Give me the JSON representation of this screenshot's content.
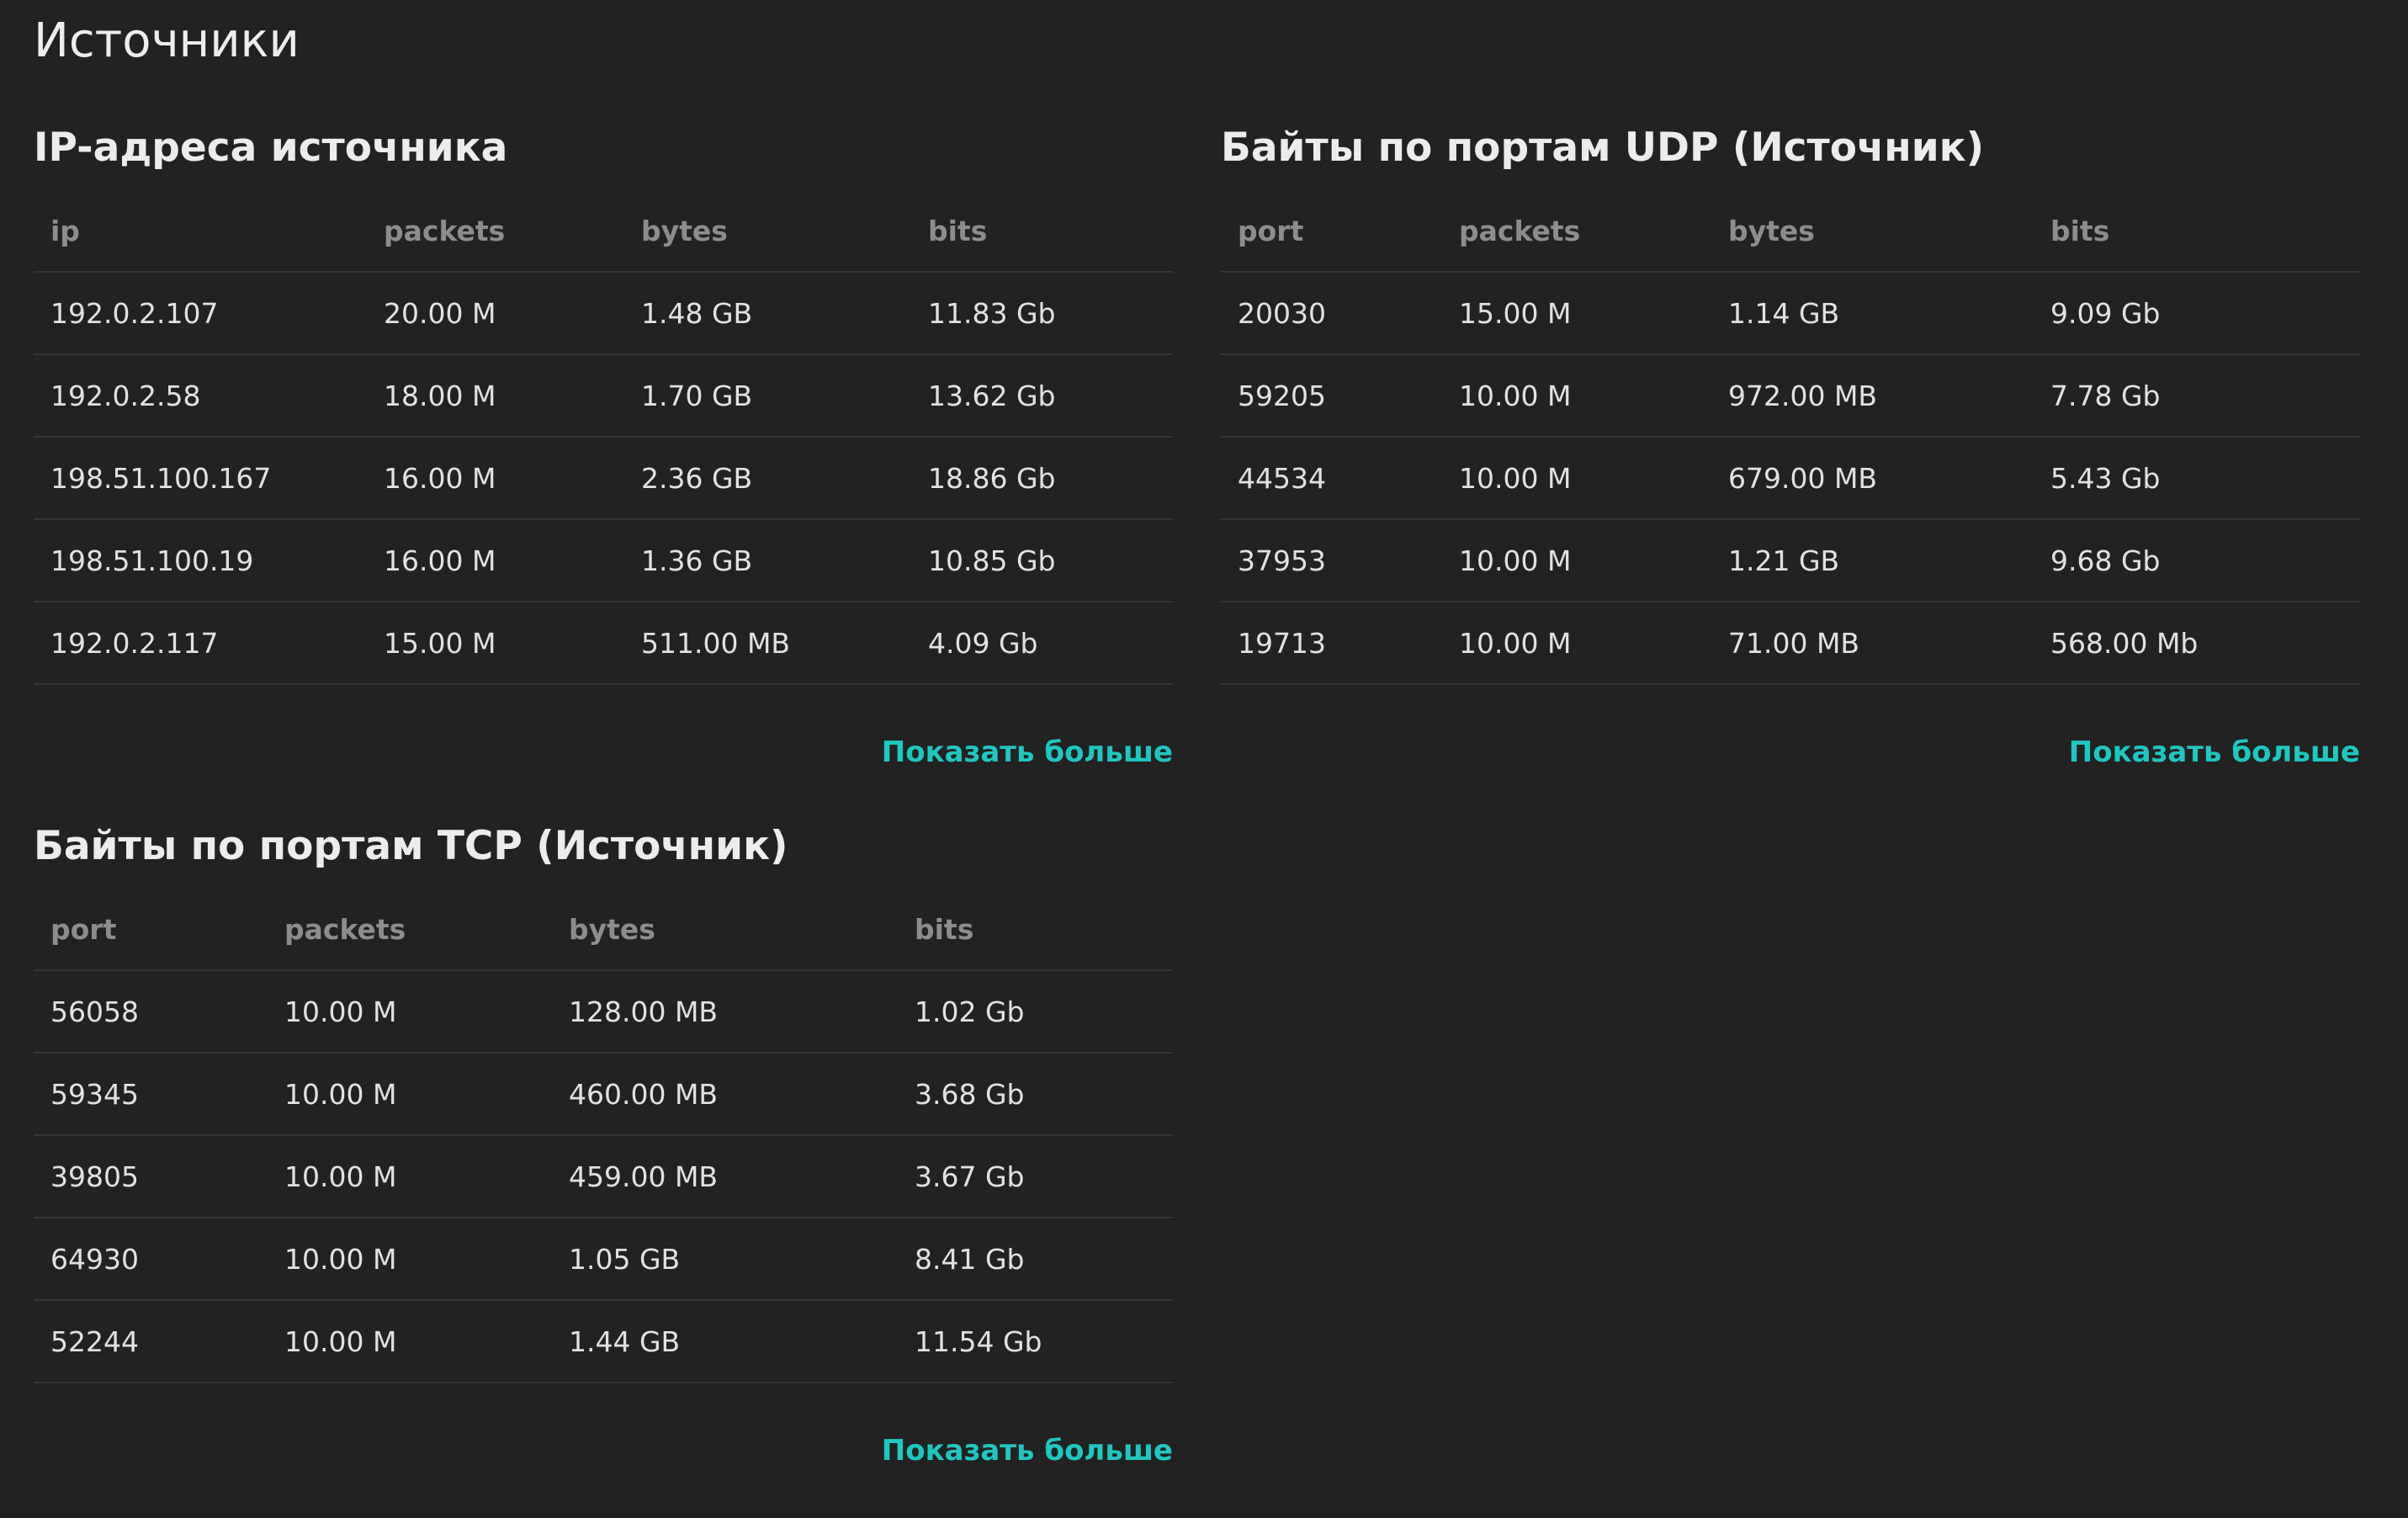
{
  "page": {
    "title": "Источники"
  },
  "cards": {
    "ip": {
      "title": "IP-адреса источника",
      "headers": [
        "ip",
        "packets",
        "bytes",
        "bits"
      ],
      "rows": [
        [
          "192.0.2.107",
          "20.00 M",
          "1.48 GB",
          "11.83 Gb"
        ],
        [
          "192.0.2.58",
          "18.00 M",
          "1.70 GB",
          "13.62 Gb"
        ],
        [
          "198.51.100.167",
          "16.00 M",
          "2.36 GB",
          "18.86 Gb"
        ],
        [
          "198.51.100.19",
          "16.00 M",
          "1.36 GB",
          "10.85 Gb"
        ],
        [
          "192.0.2.117",
          "15.00 M",
          "511.00 MB",
          "4.09 Gb"
        ]
      ],
      "more_label": "Показать больше"
    },
    "udp": {
      "title": "Байты по портам UDP (Источник)",
      "headers": [
        "port",
        "packets",
        "bytes",
        "bits"
      ],
      "rows": [
        [
          "20030",
          "15.00 M",
          "1.14 GB",
          "9.09 Gb"
        ],
        [
          "59205",
          "10.00 M",
          "972.00 MB",
          "7.78 Gb"
        ],
        [
          "44534",
          "10.00 M",
          "679.00 MB",
          "5.43 Gb"
        ],
        [
          "37953",
          "10.00 M",
          "1.21 GB",
          "9.68 Gb"
        ],
        [
          "19713",
          "10.00 M",
          "71.00 MB",
          "568.00 Mb"
        ]
      ],
      "more_label": "Показать больше"
    },
    "tcp": {
      "title": "Байты по портам TCP (Источник)",
      "headers": [
        "port",
        "packets",
        "bytes",
        "bits"
      ],
      "rows": [
        [
          "56058",
          "10.00 M",
          "128.00 MB",
          "1.02 Gb"
        ],
        [
          "59345",
          "10.00 M",
          "460.00 MB",
          "3.68 Gb"
        ],
        [
          "39805",
          "10.00 M",
          "459.00 MB",
          "3.67 Gb"
        ],
        [
          "64930",
          "10.00 M",
          "1.05 GB",
          "8.41 Gb"
        ],
        [
          "52244",
          "10.00 M",
          "1.44 GB",
          "11.54 Gb"
        ]
      ],
      "more_label": "Показать больше"
    }
  },
  "colors": {
    "background": "#222222",
    "link": "#1fc7c1",
    "header_text": "#8d8d8d",
    "divider": "#343434"
  }
}
